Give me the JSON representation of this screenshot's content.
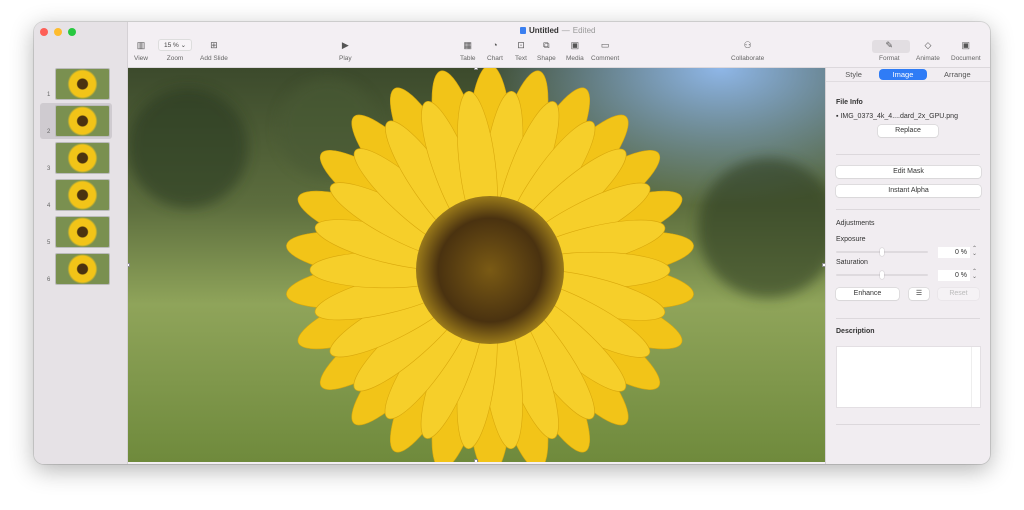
{
  "window": {
    "title": "Untitled",
    "status": "Edited"
  },
  "toolbar": {
    "view": "View",
    "zoom_value": "15 %",
    "zoom": "Zoom",
    "add_slide": "Add Slide",
    "play": "Play",
    "table": "Table",
    "chart": "Chart",
    "text": "Text",
    "shape": "Shape",
    "media": "Media",
    "comment": "Comment",
    "collaborate": "Collaborate",
    "format": "Format",
    "animate": "Animate",
    "document": "Document"
  },
  "slides": [
    {
      "n": "1"
    },
    {
      "n": "2"
    },
    {
      "n": "3"
    },
    {
      "n": "4"
    },
    {
      "n": "5"
    },
    {
      "n": "6"
    }
  ],
  "selected_slide": 2,
  "inspector": {
    "tabs": [
      "Style",
      "Image",
      "Arrange"
    ],
    "active_tab": "Image",
    "file_info": "File Info",
    "file_name": "IMG_0373_4k_4....dard_2x_GPU.png",
    "replace": "Replace",
    "edit_mask": "Edit Mask",
    "instant_alpha": "Instant Alpha",
    "adjustments": "Adjustments",
    "exposure": "Exposure",
    "exposure_value": "0 %",
    "saturation": "Saturation",
    "saturation_value": "0 %",
    "enhance": "Enhance",
    "reset": "Reset",
    "description": "Description"
  },
  "colors": {
    "accent": "#2f7cf6",
    "petal": "#f2c418",
    "center": "#4a3210"
  }
}
